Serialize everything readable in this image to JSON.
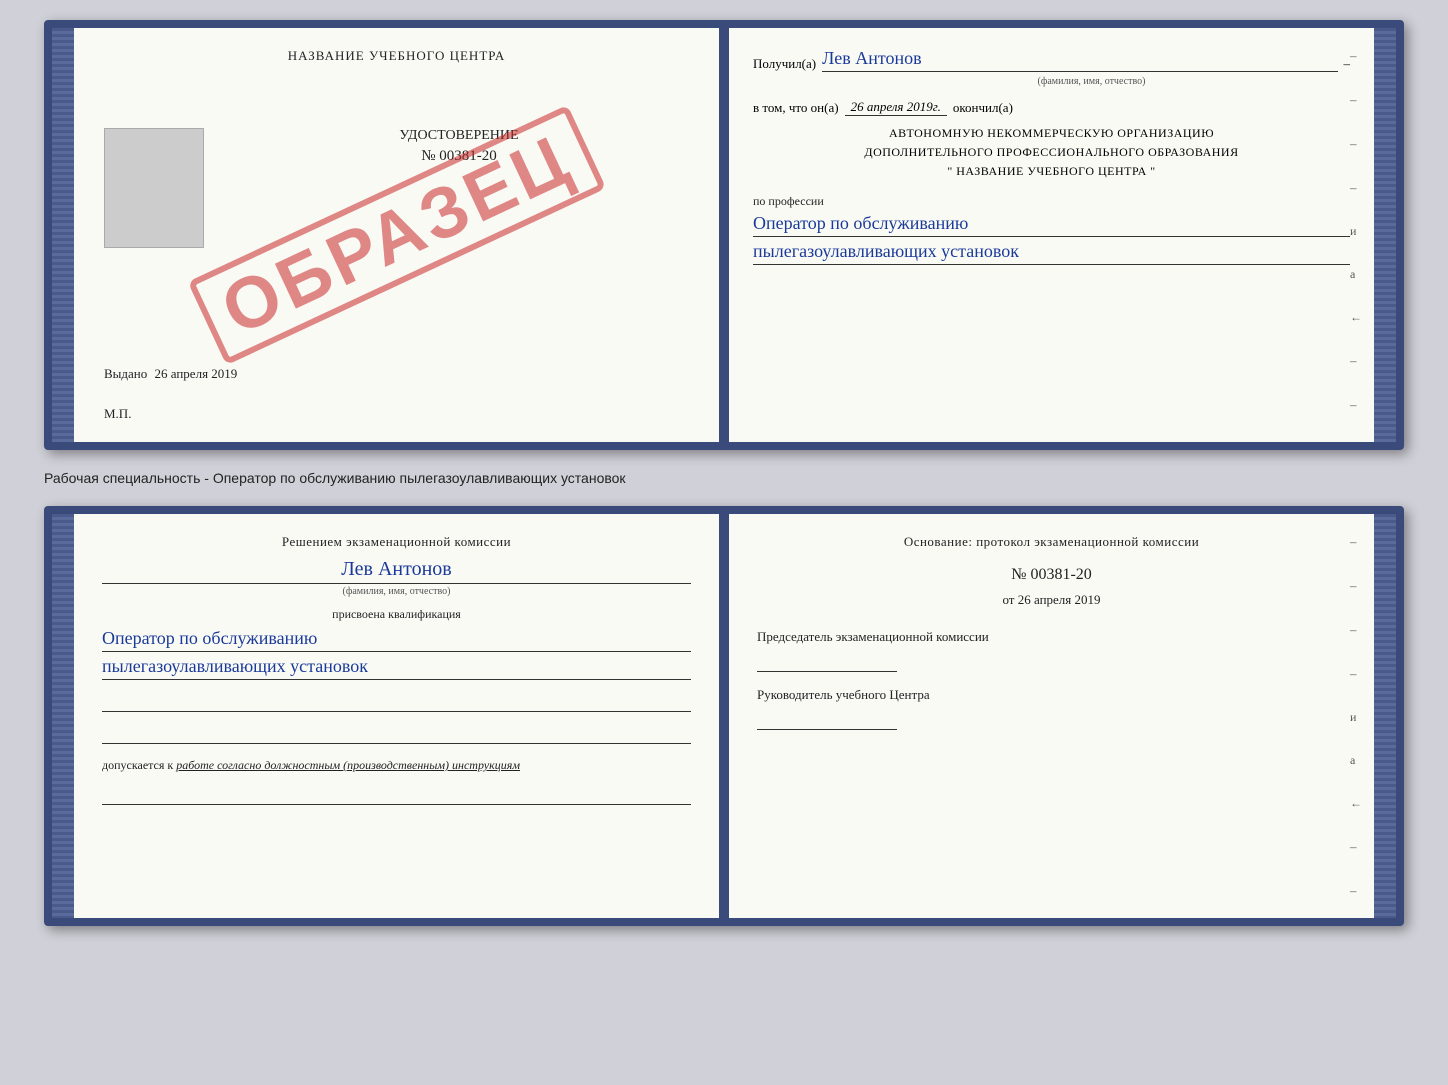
{
  "top_doc": {
    "left": {
      "title": "НАЗВАНИЕ УЧЕБНОГО ЦЕНТРА",
      "watermark": "ОБРАЗЕЦ",
      "doc_label": "УДОСТОВЕРЕНИЕ",
      "doc_number": "№ 00381-20",
      "issued_label": "Выдано",
      "issued_date": "26 апреля 2019",
      "mp_label": "М.П."
    },
    "right": {
      "received_label": "Получил(а)",
      "received_name": "Лев Антонов",
      "fio_label": "(фамилия, имя, отчество)",
      "vtom_label": "в том, что он(а)",
      "vtom_date": "26 апреля 2019г.",
      "okonchil_label": "окончил(а)",
      "org_line1": "АВТОНОМНУЮ НЕКОММЕРЧЕСКУЮ ОРГАНИЗАЦИЮ",
      "org_line2": "ДОПОЛНИТЕЛЬНОГО ПРОФЕССИОНАЛЬНОГО ОБРАЗОВАНИЯ",
      "org_line3": "\"  НАЗВАНИЕ УЧЕБНОГО ЦЕНТРА  \"",
      "po_professii": "по профессии",
      "profession1": "Оператор по обслуживанию",
      "profession2": "пылегазоулавливающих установок",
      "dashes": [
        "-",
        "-",
        "-",
        "-",
        "и",
        "а",
        "←",
        "-",
        "-"
      ]
    }
  },
  "middle_label": "Рабочая специальность - Оператор по обслуживанию пылегазоулавливающих установок",
  "bottom_doc": {
    "left": {
      "komissia_title": "Решением экзаменационной комиссии",
      "lev_name": "Лев Антонов",
      "fio_label": "(фамилия, имя, отчество)",
      "prisvoena": "присвоена квалификация",
      "qual1": "Оператор по обслуживанию",
      "qual2": "пылегазоулавливающих установок",
      "dopusk_label": "допускается к",
      "dopusk_text": "работе согласно должностным (производственным) инструкциям"
    },
    "right": {
      "osnovanie_title": "Основание: протокол экзаменационной комиссии",
      "protocol_number": "№  00381-20",
      "ot_label": "от",
      "ot_date": "26 апреля 2019",
      "predsedatel_label": "Председатель экзаменационной комиссии",
      "rukovoditel_label": "Руководитель учебного Центра",
      "dashes": [
        "-",
        "-",
        "-",
        "-",
        "и",
        "а",
        "←",
        "-",
        "-"
      ]
    }
  }
}
